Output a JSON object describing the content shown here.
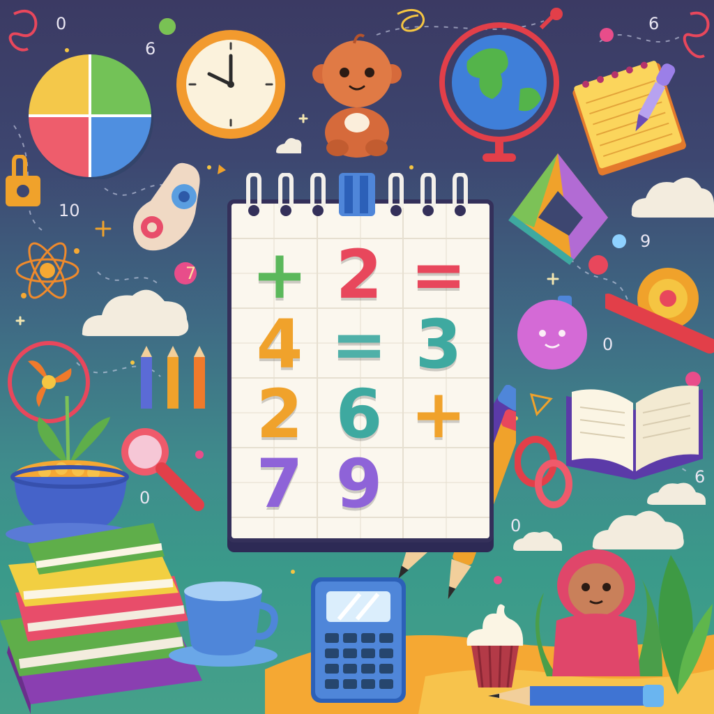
{
  "notepad": {
    "rows": [
      [
        "+",
        "2",
        "="
      ],
      [
        "4",
        "=",
        "3"
      ],
      [
        "2",
        "6",
        "+"
      ],
      [
        "7",
        "9",
        ""
      ]
    ],
    "colors": [
      [
        "#5bb85b",
        "#e8475c",
        "#e8475c"
      ],
      [
        "#f0a22b",
        "#4fb0a8",
        "#3ea9a0"
      ],
      [
        "#f0a22b",
        "#3ea9a0",
        "#f0a22b"
      ],
      [
        "#8e63d8",
        "#8e63d8",
        ""
      ]
    ]
  },
  "decor_numbers": [
    "10",
    "9",
    "0",
    "6",
    "7",
    "0",
    "6",
    "0",
    "6",
    "0"
  ],
  "icons": [
    "pie-chart-icon",
    "wall-clock-icon",
    "teddy-bear-icon",
    "globe-icon",
    "notebook-icon",
    "paintbrush-icon",
    "magnifier-icon",
    "calculator-icon",
    "cup-icon",
    "books-icon",
    "flower-pot-icon",
    "open-book-icon",
    "atom-icon",
    "cupcake-icon",
    "pencil-icon",
    "triangle-ruler-icon"
  ]
}
